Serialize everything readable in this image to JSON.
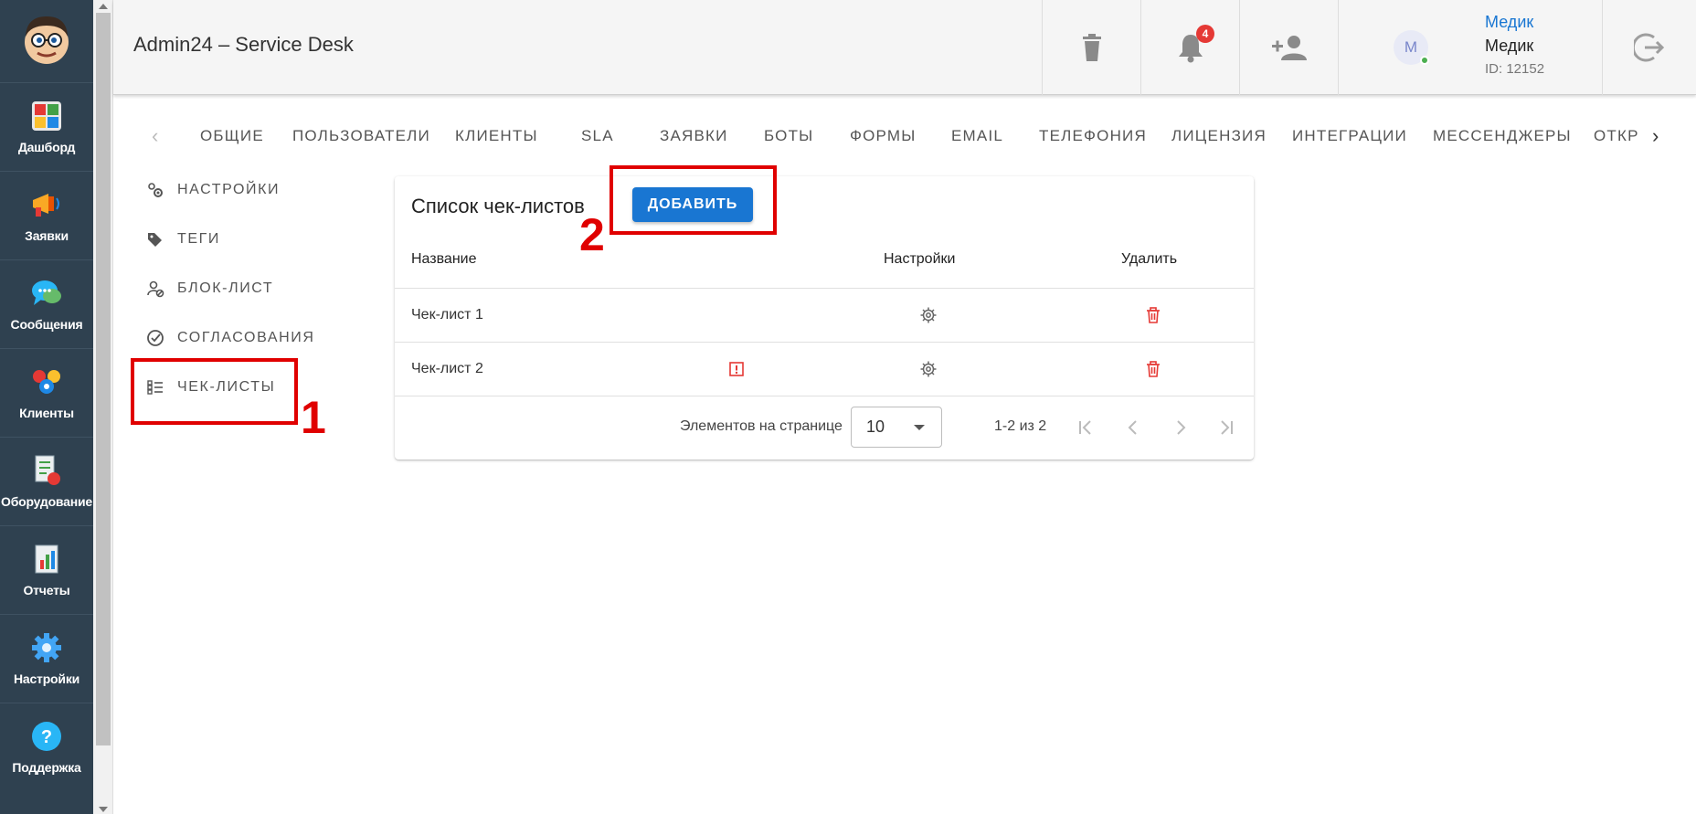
{
  "sidebar": {
    "items": [
      {
        "label": "Дашборд",
        "icon": "dashboard-icon"
      },
      {
        "label": "Заявки",
        "icon": "megaphone-icon"
      },
      {
        "label": "Сообщения",
        "icon": "chat-icon"
      },
      {
        "label": "Клиенты",
        "icon": "clients-icon"
      },
      {
        "label": "Оборудование",
        "icon": "equipment-icon"
      },
      {
        "label": "Отчеты",
        "icon": "reports-icon"
      },
      {
        "label": "Настройки",
        "icon": "gear-icon"
      },
      {
        "label": "Поддержка",
        "icon": "help-icon"
      }
    ]
  },
  "header": {
    "title": "Admin24 – Service Desk",
    "notifications_count": "4",
    "user": {
      "avatar_letter": "М",
      "link_name": "Медик",
      "name": "Медик",
      "id_text": "ID: 12152",
      "status_color": "#4caf50"
    }
  },
  "tabs": [
    "ОБЩИЕ",
    "ПОЛЬЗОВАТЕЛИ",
    "КЛИЕНТЫ",
    "SLA",
    "ЗАЯВКИ",
    "БОТЫ",
    "ФОРМЫ",
    "EMAIL",
    "ТЕЛЕФОНИЯ",
    "ЛИЦЕНЗИЯ",
    "ИНТЕГРАЦИИ",
    "МЕССЕНДЖЕРЫ",
    "ОТКР"
  ],
  "subnav": [
    "НАСТРОЙКИ",
    "ТЕГИ",
    "БЛОК-ЛИСТ",
    "СОГЛАСОВАНИЯ",
    "ЧЕК-ЛИСТЫ"
  ],
  "card": {
    "title": "Список чек-листов",
    "add_button": "ДОБАВИТЬ",
    "columns": [
      "Название",
      "Настройки",
      "Удалить"
    ],
    "rows": [
      {
        "name": "Чек-лист 1",
        "warning": false
      },
      {
        "name": "Чек-лист 2",
        "warning": true
      }
    ],
    "pager": {
      "per_page_label": "Элементов на странице",
      "per_page_value": "10",
      "range": "1-2 из 2"
    }
  },
  "annotations": [
    "1",
    "2"
  ],
  "colors": {
    "accent": "#1976d2",
    "danger": "#e53935",
    "annotation": "#e00000",
    "sidebar_bg": "#2f4150"
  }
}
